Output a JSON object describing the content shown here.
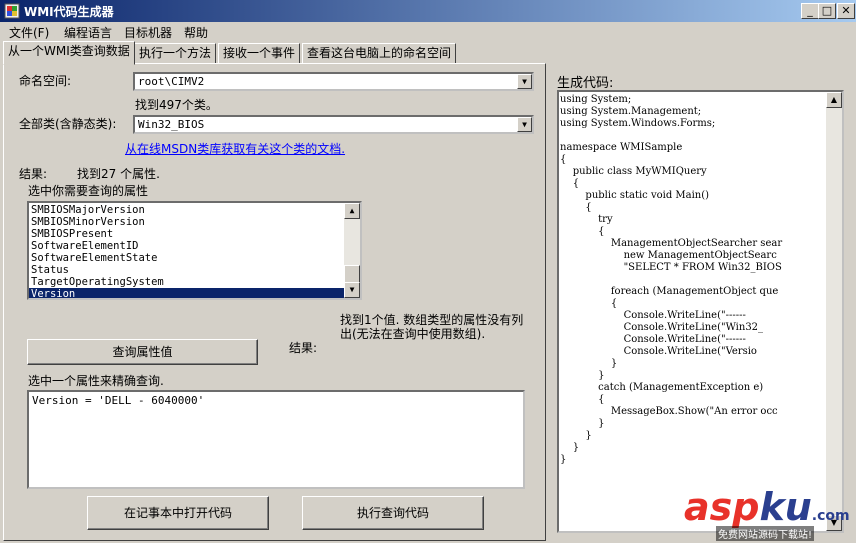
{
  "window": {
    "title": "WMI代码生成器"
  },
  "menu": [
    "文件(F)",
    "编程语言",
    "目标机器",
    "帮助"
  ],
  "tabs": [
    "从一个WMI类查询数据",
    "执行一个方法",
    "接收一个事件",
    "查看这台电脑上的命名空间"
  ],
  "query_tab": {
    "namespace_label": "命名空间:",
    "namespace_value": "root\\CIMV2",
    "class_count_text": "找到497个类。",
    "class_label": "全部类(含静态类):",
    "class_value": "Win32_BIOS",
    "msdn_link": "从在线MSDN类库获取有关这个类的文档.",
    "results_label": "结果:",
    "properties_found": "找到27 个属性.",
    "select_properties_label": "选中你需要查询的属性",
    "properties": [
      "SMBIOSMajorVersion",
      "SMBIOSMinorVersion",
      "SMBIOSPresent",
      "SoftwareElementID",
      "SoftwareElementState",
      "Status",
      "TargetOperatingSystem",
      "Version"
    ],
    "selected_property": "Version",
    "query_button": "查询属性值",
    "results_label2": "结果:",
    "value_found_text": "找到1个值. 数组类型的属性没有列出(无法在查询中使用数组).",
    "refine_label": "选中一个属性来精确查询.",
    "refine_value": "Version = 'DELL   - 6040000'",
    "open_notepad_button": "在记事本中打开代码",
    "execute_button": "执行查询代码"
  },
  "code_panel": {
    "label": "生成代码:",
    "code": "using System;\nusing System.Management;\nusing System.Windows.Forms;\n\nnamespace WMISample\n{\n    public class MyWMIQuery\n    {\n        public static void Main()\n        {\n            try\n            {\n                ManagementObjectSearcher sear\n                    new ManagementObjectSearc\n                    \"SELECT * FROM Win32_BIOS\n\n                foreach (ManagementObject que\n                {\n                    Console.WriteLine(\"------\n                    Console.WriteLine(\"Win32_\n                    Console.WriteLine(\"------\n                    Console.WriteLine(\"Versio\n                }\n            }\n            catch (ManagementException e)\n            {\n                MessageBox.Show(\"An error occ\n            }\n        }\n    }\n}"
  },
  "watermark": {
    "brand_a": "asp",
    "brand_b": "ku",
    "brand_c": ".com",
    "subtitle": "免费网站源码下载站!"
  },
  "colors": {
    "title_bar": "#0a246a",
    "selection": "#0a246a",
    "link": "#0000ff",
    "brand_red": "#e8322a",
    "brand_dark": "#2a3f8f"
  }
}
